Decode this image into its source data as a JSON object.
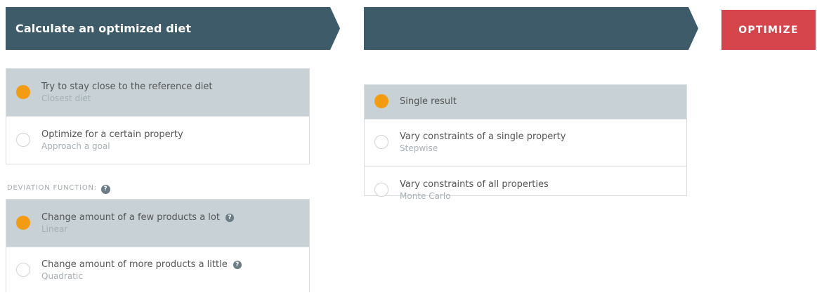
{
  "header": {
    "left_title": "Calculate an optimized diet",
    "middle_title": "",
    "optimize_label": "OPTIMIZE"
  },
  "goal_options": [
    {
      "label": "Try to stay close to the reference diet",
      "sub": "Closest diet",
      "selected": true
    },
    {
      "label": "Optimize for a certain property",
      "sub": "Approach a goal",
      "selected": false
    }
  ],
  "deviation": {
    "label": "DEVIATION FUNCTION:",
    "help_icon": "question-circle-icon",
    "options": [
      {
        "label": "Change amount of a few products a lot",
        "sub": "Linear",
        "selected": true,
        "help": "?"
      },
      {
        "label": "Change amount of more products a little",
        "sub": "Quadratic",
        "selected": false,
        "help": "?"
      }
    ]
  },
  "result_options": [
    {
      "label": "Single result",
      "sub": "",
      "selected": true
    },
    {
      "label": "Vary constraints of a single property",
      "sub": "Stepwise",
      "selected": false
    },
    {
      "label": "Vary constraints of all properties",
      "sub": "Monte Carlo",
      "selected": false
    }
  ],
  "colors": {
    "header_bg": "#3d5b69",
    "optimize_bg": "#d6454b",
    "selected_bg": "#c7d1d6",
    "radio_on": "#f39c12"
  }
}
